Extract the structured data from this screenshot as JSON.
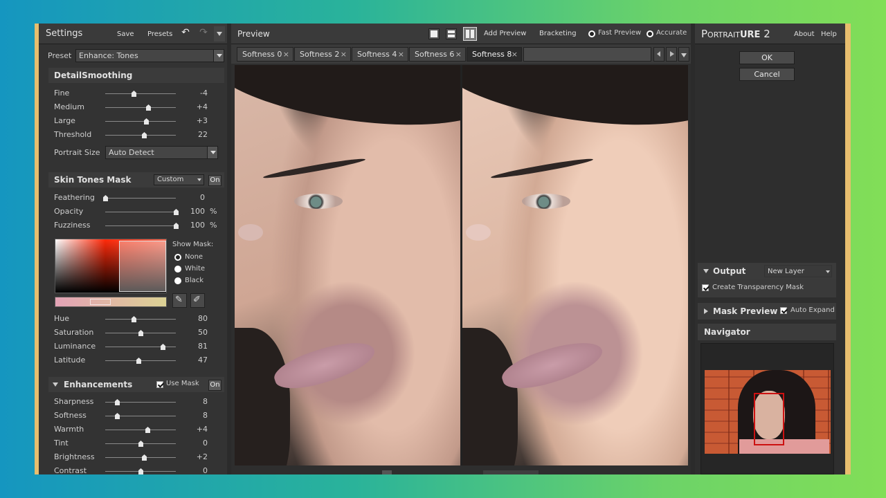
{
  "colors": {
    "accent_border": "#e8be6e",
    "panel": "#333333",
    "nav_box": "#cc1111"
  },
  "settings": {
    "title": "Settings",
    "save": "Save",
    "presets": "Presets",
    "preset_label": "Preset",
    "preset_value": "Enhance: Tones",
    "detail": {
      "title": "DetailSmoothing",
      "sliders": [
        {
          "label": "Fine",
          "value": "-4",
          "level": 0.4
        },
        {
          "label": "Medium",
          "value": "+4",
          "level": 0.61
        },
        {
          "label": "Large",
          "value": "+3",
          "level": 0.58
        },
        {
          "label": "Threshold",
          "value": "22",
          "level": 0.55
        }
      ],
      "portrait_size_label": "Portrait Size",
      "portrait_size_value": "Auto Detect"
    },
    "skin": {
      "title": "Skin Tones Mask",
      "mode": "Custom",
      "on": "On",
      "sliders": [
        {
          "label": "Feathering",
          "value": "0",
          "unit": "",
          "level": 0.0
        },
        {
          "label": "Opacity",
          "value": "100",
          "unit": "%",
          "level": 1.0
        },
        {
          "label": "Fuzziness",
          "value": "100",
          "unit": "%",
          "level": 1.0
        }
      ],
      "show_mask": {
        "label": "Show Mask:",
        "options": [
          "None",
          "White",
          "Black"
        ],
        "selected": "None"
      },
      "sliders2": [
        {
          "label": "Hue",
          "value": "80",
          "level": 0.4
        },
        {
          "label": "Saturation",
          "value": "50",
          "level": 0.5
        },
        {
          "label": "Luminance",
          "value": "81",
          "level": 0.81
        },
        {
          "label": "Latitude",
          "value": "47",
          "level": 0.47
        }
      ]
    },
    "enh": {
      "title": "Enhancements",
      "use_mask": "Use Mask",
      "on": "On",
      "sliders": [
        {
          "label": "Sharpness",
          "value": "8",
          "level": 0.17
        },
        {
          "label": "Softness",
          "value": "8",
          "level": 0.17
        },
        {
          "label": "Warmth",
          "value": "+4",
          "level": 0.6
        },
        {
          "label": "Tint",
          "value": "0",
          "level": 0.5
        },
        {
          "label": "Brightness",
          "value": "+2",
          "level": 0.55
        },
        {
          "label": "Contrast",
          "value": "0",
          "level": 0.5
        }
      ]
    }
  },
  "preview": {
    "title": "Preview",
    "add_preview": "Add Preview",
    "bracketing": "Bracketing",
    "fast_preview": "Fast Preview",
    "accurate": "Accurate",
    "tabs": [
      "Softness 0",
      "Softness 2",
      "Softness 4",
      "Softness 6",
      "Softness 8"
    ],
    "active_tab": "Softness 8"
  },
  "right": {
    "brand_prefix": "Portrait",
    "brand_suffix": "ure",
    "brand_version": "2",
    "about": "About",
    "help": "Help",
    "ok": "OK",
    "cancel": "Cancel",
    "output": {
      "title": "Output",
      "value": "New Layer",
      "transparency": "Create Transparency Mask"
    },
    "mask_preview": {
      "title": "Mask Preview",
      "auto_expand": "Auto Expand"
    },
    "navigator": {
      "title": "Navigator"
    }
  }
}
